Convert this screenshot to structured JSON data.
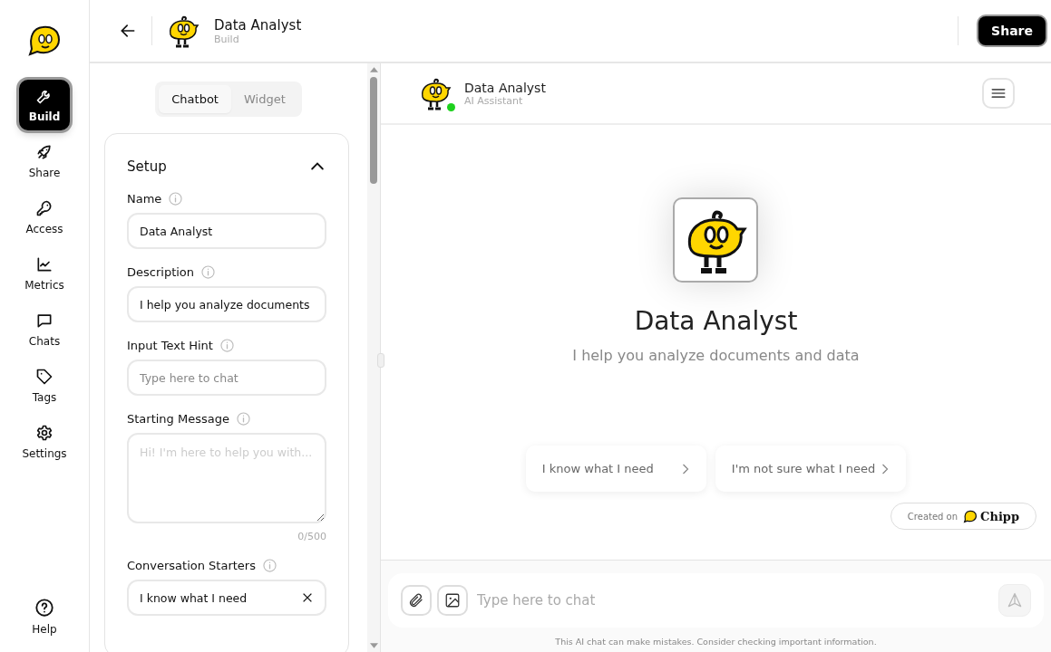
{
  "nav": {
    "items": [
      {
        "label": "Build",
        "selected": true
      },
      {
        "label": "Share",
        "selected": false
      },
      {
        "label": "Access",
        "selected": false
      },
      {
        "label": "Metrics",
        "selected": false
      },
      {
        "label": "Chats",
        "selected": false
      },
      {
        "label": "Tags",
        "selected": false
      },
      {
        "label": "Settings",
        "selected": false
      }
    ],
    "help": "Help"
  },
  "header": {
    "title": "Data Analyst",
    "subtitle": "Build",
    "share_button": "Share"
  },
  "tabs": [
    {
      "label": "Chatbot",
      "selected": true
    },
    {
      "label": "Widget",
      "selected": false
    }
  ],
  "setup": {
    "title": "Setup",
    "expanded": true,
    "fields": [
      {
        "kind": "input",
        "label": "Name",
        "value": "Data Analyst"
      },
      {
        "kind": "input",
        "label": "Description",
        "value": "I help you analyze documents"
      },
      {
        "kind": "input",
        "label": "Input Text Hint",
        "placeholder": "Type here to chat"
      },
      {
        "kind": "textarea",
        "label": "Starting Message",
        "placeholder": "Hi! I'm here to help you with...",
        "counter": "0/500"
      },
      {
        "kind": "removable",
        "label": "Conversation Starters",
        "value": "I know what I need"
      }
    ]
  },
  "preview": {
    "name": "Data Analyst",
    "subtitle": "AI Assistant",
    "online": true,
    "hero_title": "Data Analyst",
    "hero_description": "I help you analyze documents and data",
    "starters": [
      "I know what I need",
      "I'm not sure what I need"
    ],
    "created_on": "Created on",
    "brand": "Chipp",
    "composer_placeholder": "Type here to chat",
    "disclaimer": "This AI chat can make mistakes. Consider checking important information."
  }
}
